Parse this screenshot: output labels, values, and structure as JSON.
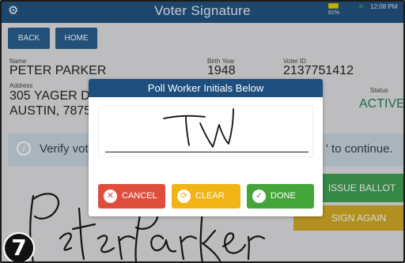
{
  "header": {
    "title": "Voter Signature",
    "battery_percent": "81%",
    "time": "12:08 PM"
  },
  "nav": {
    "back_label": "BACK",
    "home_label": "HOME"
  },
  "voter": {
    "name_label": "Name",
    "name": "PETER PARKER",
    "birth_year_label": "Birth Year",
    "birth_year": "1948",
    "voter_id_label": "Voter ID",
    "voter_id": "2137751412",
    "address_label": "Address",
    "address_line1": "305 YAGER D",
    "address_line2": "AUSTIN, 7875",
    "status_label": "Status",
    "status": "ACTIVE"
  },
  "banner": {
    "text_left": "Verify vot",
    "text_right": "' to continue."
  },
  "actions": {
    "issue_ballot": "ISSUE BALLOT",
    "sign_again": "SIGN AGAIN"
  },
  "modal": {
    "title": "Poll Worker Initials Below",
    "cancel_label": "CANCEL",
    "clear_label": "CLEAR",
    "done_label": "DONE"
  },
  "step_badge": "7",
  "colors": {
    "header": "#1d4e7d",
    "cancel": "#df4e3d",
    "clear": "#f1b416",
    "done": "#43a53a",
    "issue": "#3b9d4d",
    "sign_again": "#d0a81f",
    "active": "#1f7a52"
  }
}
